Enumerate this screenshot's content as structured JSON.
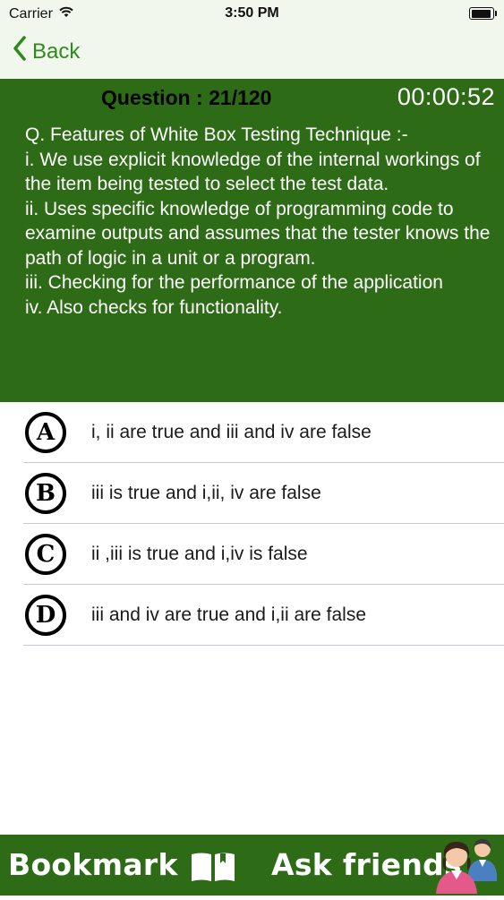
{
  "status_bar": {
    "carrier": "Carrier",
    "time": "3:50 PM"
  },
  "nav": {
    "back_label": "Back"
  },
  "question": {
    "counter": "Question : 21/120",
    "timer": "00:00:52",
    "text": "Q. Features of White Box Testing Technique :-\ni. We use explicit knowledge of the internal workings of the item being tested to select the test data.\nii. Uses specific knowledge of programming code to examine outputs and assumes that the tester knows the path of logic in a unit or a program.\niii. Checking for the performance of the application\niv. Also checks for functionality."
  },
  "options": [
    {
      "letter": "A",
      "text": "i, ii are true and iii and iv are false"
    },
    {
      "letter": "B",
      "text": "iii is true and i,ii, iv are false"
    },
    {
      "letter": "C",
      "text": "ii ,iii is true and i,iv is false"
    },
    {
      "letter": "D",
      "text": "iii and iv are true and i,ii are false"
    }
  ],
  "bottom_bar": {
    "bookmark_label": "Bookmark",
    "ask_label": "Ask friends"
  },
  "colors": {
    "header_green": "#2e6b16",
    "accent_green": "#2f8a1e",
    "nav_bg": "#f1f7ec"
  },
  "icons": [
    "wifi-icon",
    "battery-icon",
    "chevron-left-icon",
    "book-icon",
    "friends-icon"
  ]
}
